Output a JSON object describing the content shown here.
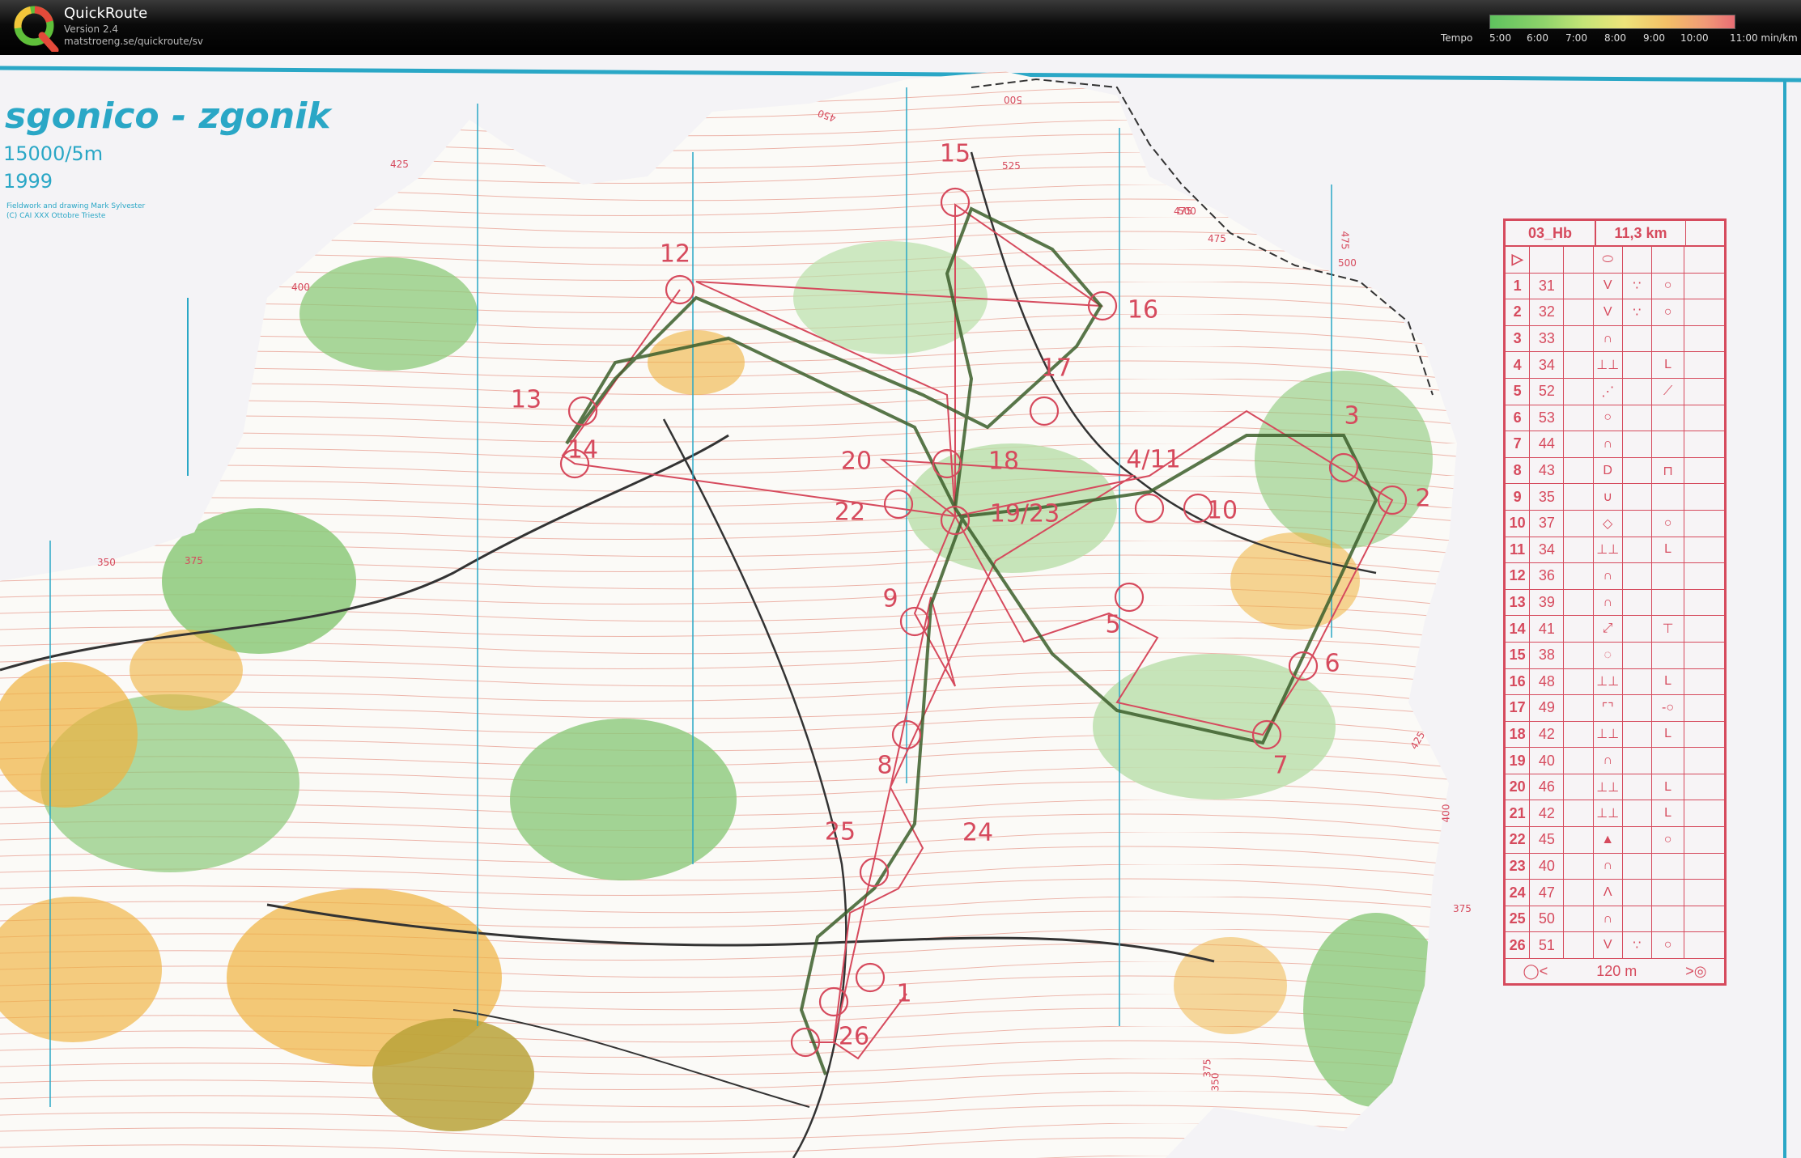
{
  "app": {
    "title": "QuickRoute",
    "version": "Version 2.4",
    "url": "matstroeng.se/quickroute/sv"
  },
  "tempo": {
    "label": "Tempo",
    "ticks": [
      "5:00",
      "6:00",
      "7:00",
      "8:00",
      "9:00",
      "10:00",
      "11:00"
    ],
    "unit": "min/km"
  },
  "map": {
    "name": "sgonico - zgonik",
    "scale": "15000/5m",
    "year": "1999",
    "credit_line1": "Fieldwork and drawing Mark Sylvester",
    "credit_line2": "(C) CAI XXX Ottobre Trieste",
    "colors": {
      "accent": "#2aa7c6",
      "course": "#d64a5d",
      "forest": "#8cc97a",
      "open": "#f0b23e"
    }
  },
  "contour_labels": [
    "425",
    "450",
    "500",
    "475",
    "525",
    "500",
    "475",
    "500",
    "475",
    "425",
    "400",
    "375",
    "350",
    "375",
    "400",
    "350",
    "375"
  ],
  "controls": [
    {
      "label": "15"
    },
    {
      "label": "12"
    },
    {
      "label": "16"
    },
    {
      "label": "17"
    },
    {
      "label": "13"
    },
    {
      "label": "14"
    },
    {
      "label": "3"
    },
    {
      "label": "20"
    },
    {
      "label": "18"
    },
    {
      "label": "4/11"
    },
    {
      "label": "2"
    },
    {
      "label": "22"
    },
    {
      "label": "19/23"
    },
    {
      "label": "10"
    },
    {
      "label": "9"
    },
    {
      "label": "5"
    },
    {
      "label": "6"
    },
    {
      "label": "8"
    },
    {
      "label": "7"
    },
    {
      "label": "25"
    },
    {
      "label": "24"
    },
    {
      "label": "1"
    },
    {
      "label": "26"
    }
  ],
  "description_sheet": {
    "course": "03_Hb",
    "length": "11,3 km",
    "rows": [
      {
        "n": "1",
        "code": "31",
        "d": "V",
        "e": "∵",
        "g": "○"
      },
      {
        "n": "2",
        "code": "32",
        "d": "V",
        "e": "∵",
        "g": "○"
      },
      {
        "n": "3",
        "code": "33",
        "d": "∩",
        "e": "",
        "g": ""
      },
      {
        "n": "4",
        "code": "34",
        "d": "⊥⊥",
        "e": "",
        "g": "L"
      },
      {
        "n": "5",
        "code": "52",
        "d": "⋰",
        "e": "",
        "g": "⟋"
      },
      {
        "n": "6",
        "code": "53",
        "d": "○",
        "e": "",
        "g": ""
      },
      {
        "n": "7",
        "code": "44",
        "d": "∩",
        "e": "",
        "g": ""
      },
      {
        "n": "8",
        "code": "43",
        "d": "D",
        "e": "",
        "g": "⊓"
      },
      {
        "n": "9",
        "code": "35",
        "d": "∪",
        "e": "",
        "g": ""
      },
      {
        "n": "10",
        "code": "37",
        "d": "◇",
        "e": "",
        "g": "○"
      },
      {
        "n": "11",
        "code": "34",
        "d": "⊥⊥",
        "e": "",
        "g": "L"
      },
      {
        "n": "12",
        "code": "36",
        "d": "∩",
        "e": "",
        "g": ""
      },
      {
        "n": "13",
        "code": "39",
        "d": "∩",
        "e": "",
        "g": ""
      },
      {
        "n": "14",
        "code": "41",
        "d": "⤢",
        "e": "",
        "g": "⊤"
      },
      {
        "n": "15",
        "code": "38",
        "d": "◌",
        "e": "",
        "g": ""
      },
      {
        "n": "16",
        "code": "48",
        "d": "⊥⊥",
        "e": "",
        "g": "L"
      },
      {
        "n": "17",
        "code": "49",
        "d": "⌜⌝",
        "e": "",
        "g": "-○"
      },
      {
        "n": "18",
        "code": "42",
        "d": "⊥⊥",
        "e": "",
        "g": "L"
      },
      {
        "n": "19",
        "code": "40",
        "d": "∩",
        "e": "",
        "g": ""
      },
      {
        "n": "20",
        "code": "46",
        "d": "⊥⊥",
        "e": "",
        "g": "L"
      },
      {
        "n": "21",
        "code": "42",
        "d": "⊥⊥",
        "e": "",
        "g": "L"
      },
      {
        "n": "22",
        "code": "45",
        "d": "▲",
        "e": "",
        "g": "○"
      },
      {
        "n": "23",
        "code": "40",
        "d": "∩",
        "e": "",
        "g": ""
      },
      {
        "n": "24",
        "code": "47",
        "d": "Λ",
        "e": "",
        "g": ""
      },
      {
        "n": "25",
        "code": "50",
        "d": "∩",
        "e": "",
        "g": ""
      },
      {
        "n": "26",
        "code": "51",
        "d": "V",
        "e": "∵",
        "g": "○"
      }
    ],
    "footer": "120 m"
  }
}
